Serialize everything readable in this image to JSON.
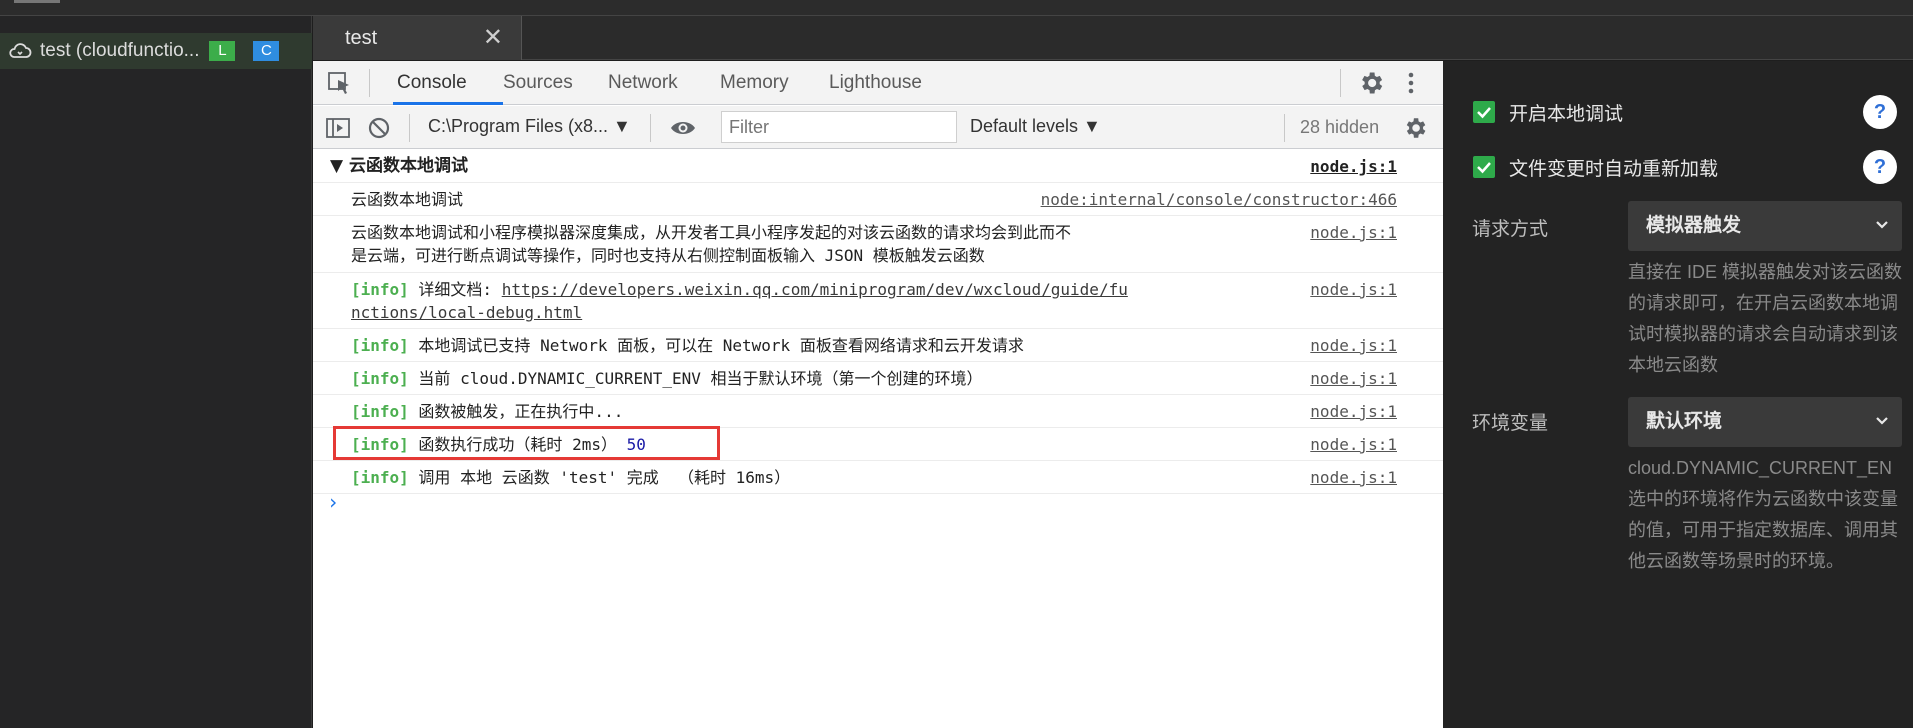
{
  "sidebar": {
    "project_name": "test (cloudfunctio...",
    "badge_l": "L",
    "badge_c": "C",
    "icon": "cloud-icon"
  },
  "tabbar": {
    "tab_label": "test",
    "close_glyph": "✕"
  },
  "devtools": {
    "tabs": [
      "Console",
      "Sources",
      "Network",
      "Memory",
      "Lighthouse"
    ],
    "active_tab": "Console",
    "toolbar": {
      "context": "C:\\Program Files (x8... ▼",
      "filter_placeholder": "Filter",
      "levels": "Default levels ▼",
      "hidden_count": "28 hidden"
    }
  },
  "console": {
    "group_title": "▼ 云函数本地调试",
    "group_src": "node.js:1",
    "rows": [
      {
        "text": "云函数本地调试",
        "src": "node:internal/console/constructor:466"
      },
      {
        "text": "云函数本地调试和小程序模拟器深度集成，从开发者工具小程序发起的对该云函数的请求均会到此而不\n是云端，可进行断点调试等操作，同时也支持从右侧控制面板输入 JSON 模板触发云函数",
        "src": "node.js:1"
      },
      {
        "tag": "[info]",
        "text": " 详细文档: ",
        "link": "https://developers.weixin.qq.com/miniprogram/dev/wxcloud/guide/functions/local-debug.html",
        "src": "node.js:1"
      },
      {
        "tag": "[info]",
        "text": " 本地调试已支持 Network 面板，可以在 Network 面板查看网络请求和云开发请求",
        "src": "node.js:1"
      },
      {
        "tag": "[info]",
        "text": " 当前 cloud.DYNAMIC_CURRENT_ENV 相当于默认环境（第一个创建的环境）",
        "src": "node.js:1"
      },
      {
        "tag": "[info]",
        "text": " 函数被触发，正在执行中...",
        "src": "node.js:1"
      },
      {
        "tag": "[info]",
        "text": " 函数执行成功（耗时 2ms） ",
        "value": "50",
        "src": "node.js:1"
      },
      {
        "tag": "[info]",
        "text": " 调用 本地 云函数 'test' 完成  （耗时 16ms）",
        "src": "node.js:1"
      }
    ],
    "prompt": "›"
  },
  "settings": {
    "check1": "开启本地调试",
    "check2": "文件变更时自动重新加载",
    "help": "?",
    "request_label": "请求方式",
    "request_value": "模拟器触发",
    "request_desc": "直接在 IDE 模拟器触发对该云函数的请求即可，在开启云函数本地调试时模拟器的请求会自动请求到该本地云函数",
    "env_label": "环境变量",
    "env_value": "默认环境",
    "env_desc_line1": "cloud.DYNAMIC_CURRENT_EN",
    "env_desc": "选中的环境将作为云函数中该变量的值，可用于指定数据库、调用其他云函数等场景时的环境。"
  },
  "colors": {
    "info": "#4caf50",
    "accent": "#1a73e8",
    "highlight": "#e53935",
    "check": "#2eaa4a"
  }
}
